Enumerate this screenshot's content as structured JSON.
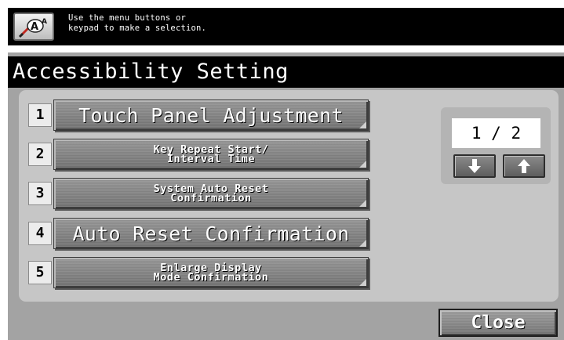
{
  "message": {
    "text": "Use the menu buttons or\nkeypad to make a selection.",
    "icon": "accessibility-icon"
  },
  "title": "Accessibility Setting",
  "items": [
    {
      "num": "1",
      "label": "Touch Panel Adjustment"
    },
    {
      "num": "2",
      "label": "Key Repeat Start/\nInterval Time"
    },
    {
      "num": "3",
      "label": "System Auto Reset\nConfirmation"
    },
    {
      "num": "4",
      "label": "Auto Reset Confirmation"
    },
    {
      "num": "5",
      "label": "Enlarge Display\nMode Confirmation"
    }
  ],
  "pager": {
    "indicator": "1 / 2",
    "down_icon": "arrow-down-icon",
    "up_icon": "arrow-up-icon"
  },
  "close_label": "Close"
}
